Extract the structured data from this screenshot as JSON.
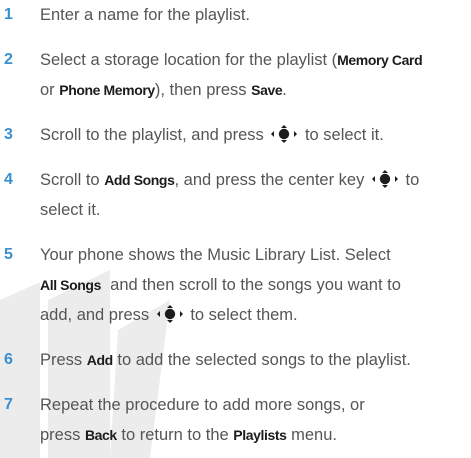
{
  "colors": {
    "step_number": "#3a8fd0",
    "body_text": "#555555",
    "key_text": "#1c1c1c",
    "watermark": "#ececec"
  },
  "icons": {
    "nav_key": "navigation-center-key-icon"
  },
  "steps": [
    {
      "number": "1",
      "lines": [
        {
          "t1": "Enter a name for the playlist."
        }
      ]
    },
    {
      "number": "2",
      "lines": [
        {
          "t1": "Select a storage location for the playlist (",
          "k1": "Memory Card"
        },
        {
          "t1": "or ",
          "k1": "Phone Memory",
          "t2": "), then press ",
          "k2": "Save",
          "t3": "."
        }
      ]
    },
    {
      "number": "3",
      "lines": [
        {
          "t1": "Scroll to the playlist, and press ",
          "t2": " to select it."
        }
      ]
    },
    {
      "number": "4",
      "lines": [
        {
          "t1": "Scroll to ",
          "k1": "Add Songs",
          "t2": ", and press the center key ",
          "t3": " to"
        },
        {
          "t1": "select it."
        }
      ]
    },
    {
      "number": "5",
      "lines": [
        {
          "t1": "Your phone shows the Music Library List. Select"
        },
        {
          "k1": "All Songs",
          "t1": "  and then scroll to the songs you want to"
        },
        {
          "t1": "add, and press ",
          "t2": " to select them."
        }
      ]
    },
    {
      "number": "6",
      "lines": [
        {
          "t1": "Press ",
          "k1": "Add",
          "t2": " to add the selected songs to the playlist."
        }
      ]
    },
    {
      "number": "7",
      "lines": [
        {
          "t1": "Repeat the procedure to add more songs, or"
        },
        {
          "t1": "press ",
          "k1": "Back",
          "t2": " to return to the ",
          "k2": "Playlists",
          "t3": " menu."
        }
      ]
    }
  ]
}
